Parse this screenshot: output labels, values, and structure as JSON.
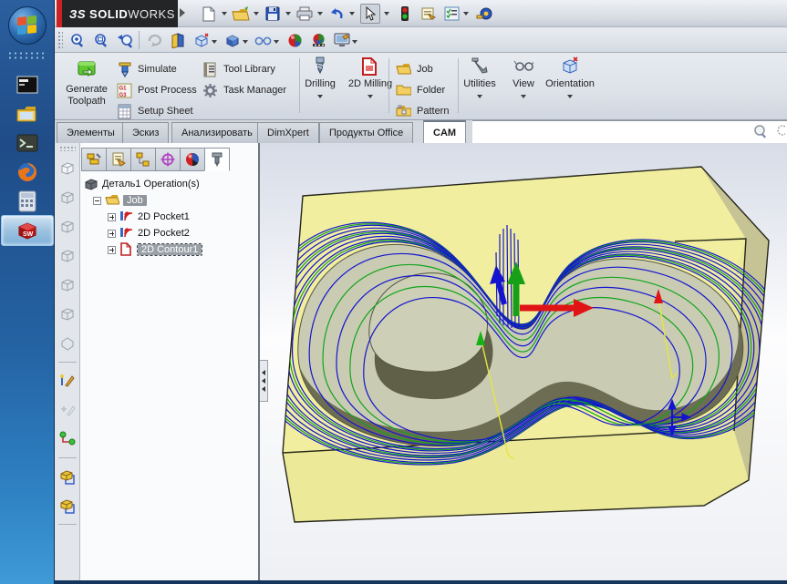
{
  "taskbar": {
    "items": [
      "start-orb",
      "command-prompt",
      "file-explorer",
      "terminal",
      "firefox",
      "calculator",
      "solidworks"
    ],
    "active_item": "solidworks"
  },
  "titlebar": {
    "brand": {
      "mark": "ЗS",
      "name_bold": "SOLID",
      "name_light": "WORKS"
    },
    "main_toolbar_icons": [
      "new-document",
      "open",
      "save",
      "print",
      "undo",
      "select-cursor",
      "rebuild-traffic-light",
      "file-properties",
      "design-checker",
      "measure-tape"
    ],
    "view_toolbar_icons": [
      "zoom-to-fit",
      "zoom-to-area",
      "zoom-previous",
      "rotate-view",
      "section-view",
      "view-orientation",
      "display-style",
      "hide-show-items",
      "edit-appearance",
      "apply-scene",
      "view-settings"
    ]
  },
  "ribbon": {
    "generate_toolpath": "Generate Toolpath",
    "simulate": "Simulate",
    "post_process": "Post Process",
    "setup_sheet": "Setup Sheet",
    "tool_library": "Tool Library",
    "task_manager": "Task Manager",
    "drilling": "Drilling",
    "milling_2d": "2D Milling",
    "job": "Job",
    "folder": "Folder",
    "pattern": "Pattern",
    "utilities": "Utilities",
    "view": "View",
    "orientation": "Orientation"
  },
  "document_tabs": {
    "items": [
      "Элементы",
      "Эскиз",
      "Анализировать",
      "DimXpert",
      "Продукты Office",
      "CAM"
    ],
    "active": "CAM"
  },
  "feature_tree": {
    "manager_tabs": [
      "feature-manager",
      "property-manager",
      "configuration-manager",
      "dimxpert-manager",
      "display-manager",
      "cam-manager"
    ],
    "root_label": "Деталь1 Operation(s)",
    "items": [
      "Job",
      "2D Pocket1",
      "2D Pocket2",
      "2D Contour1"
    ],
    "selected_item": "2D Contour1"
  },
  "viewport": {
    "colors": {
      "block_top": "#f1ef9f",
      "block_face": "#ecea98",
      "block_side": "#c6c494",
      "pocket_floor": "#c9ccb3",
      "pocket_wall": "#6c6d52",
      "toolpath_blue": "#1414cf",
      "toolpath_green": "#12a41c",
      "axis_red": "#e01414",
      "axis_green": "#17a017",
      "axis_blue": "#1414cf",
      "leader_yellow": "#e6e640"
    },
    "rings": [
      {
        "s": 1.2,
        "c": "b"
      },
      {
        "s": 1.1875,
        "c": "g"
      },
      {
        "s": 1.175,
        "c": "b"
      },
      {
        "s": 1.15,
        "c": "b"
      },
      {
        "s": 1.125,
        "c": "b"
      },
      {
        "s": 1.1125,
        "c": "g"
      },
      {
        "s": 1.1,
        "c": "b"
      },
      {
        "s": 1.075,
        "c": "b"
      },
      {
        "s": 1.05,
        "c": "b"
      },
      {
        "s": 1.0375,
        "c": "g"
      },
      {
        "s": 1.025,
        "c": "b"
      },
      {
        "s": 0.95,
        "c": "b"
      },
      {
        "s": 0.89,
        "c": "g"
      },
      {
        "s": 0.83,
        "c": "b"
      },
      {
        "s": 0.77,
        "c": "g"
      },
      {
        "s": 0.71,
        "c": "b"
      }
    ]
  }
}
